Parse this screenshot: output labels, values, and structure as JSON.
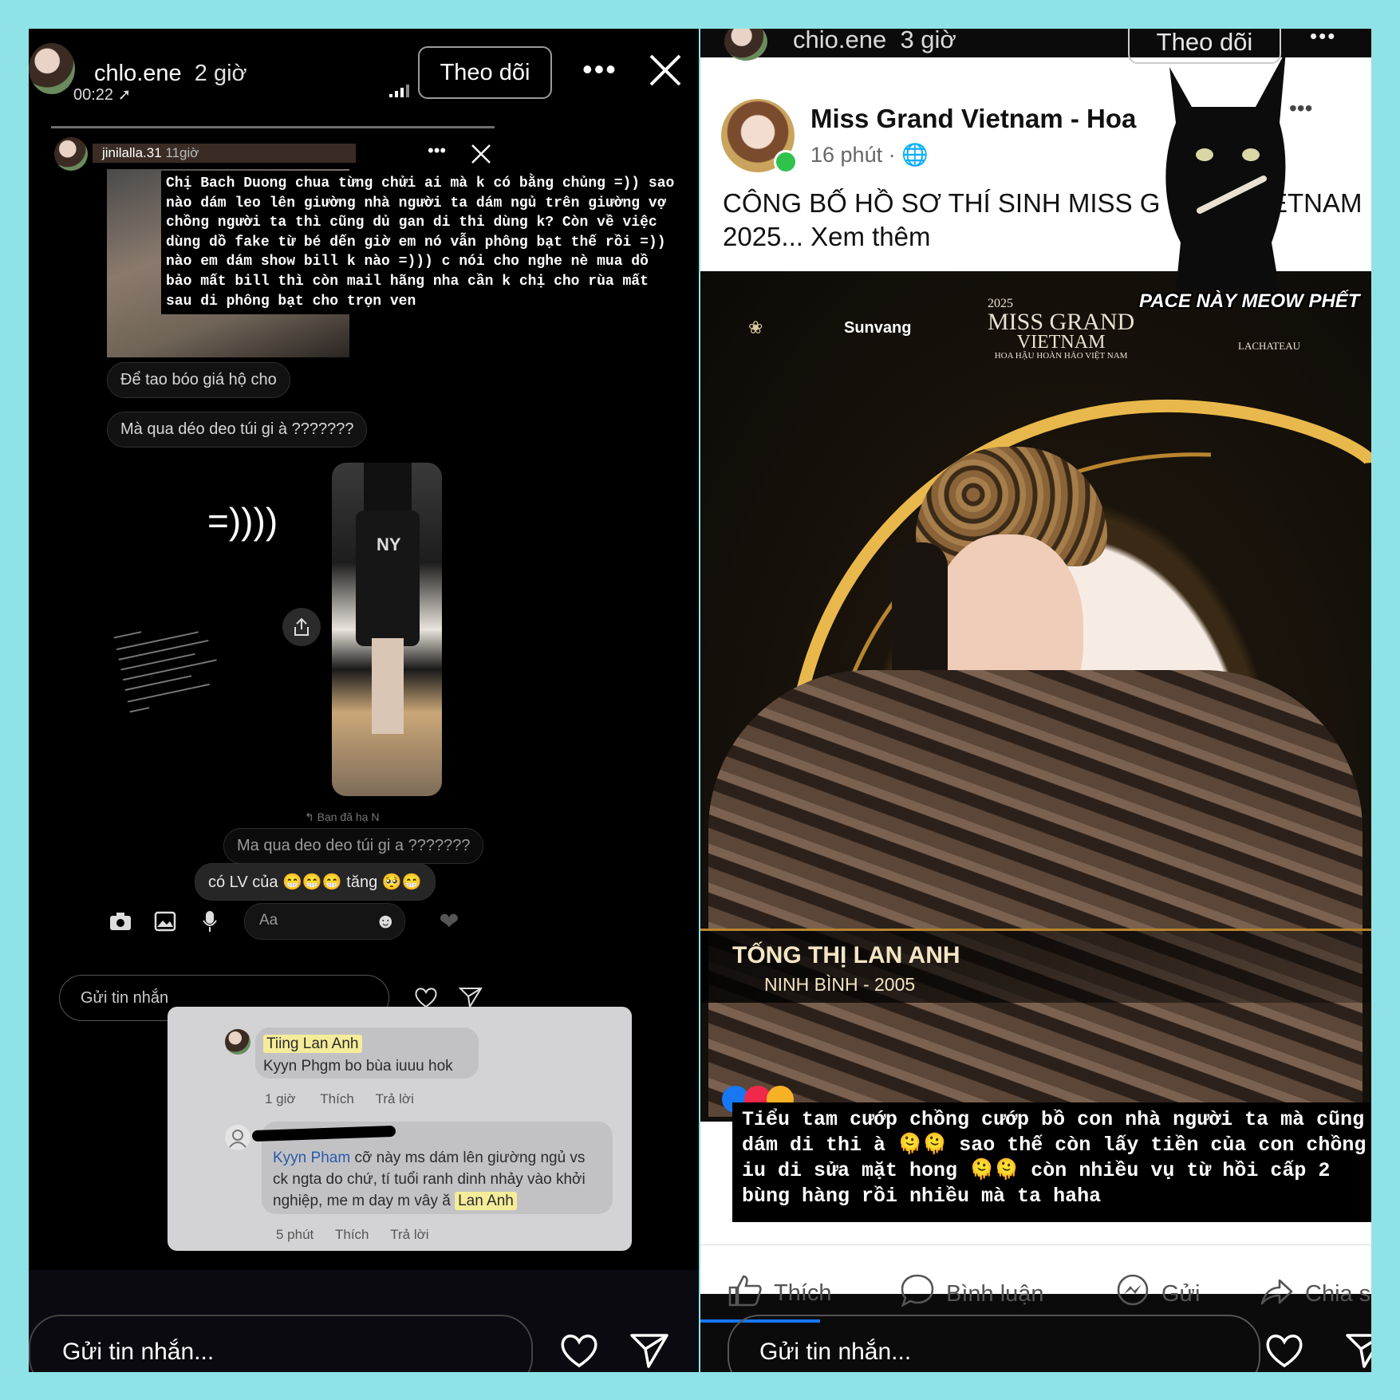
{
  "left": {
    "user": {
      "name": "chlo.ene",
      "time": "2 giờ",
      "sub_time": "00:22"
    },
    "follow_label": "Theo dõi",
    "chat": {
      "header_user": "jinilalla.31",
      "header_time": "11giờ",
      "long_message": "Chị Bach Duong chua từng chửi ai mà k có bằng chủng =)) sao nào dám leo lên giường nhà người ta dám ngủ trên giường vợ chồng người ta thì cũng dủ gan di thi dùng k? Còn về việc dùng dồ fake từ bé dến giờ em nó vẫn phông bạt thế rồi =)) nào em dám show bill k nào =))) c nói cho nghe nè mua dồ bảo mất bill thì còn mail hãng nha cần k chị cho rùa mất sau di phông bạt cho trọn ven",
      "bubble1": "Để tao bóo giá hộ cho",
      "bubble2": "Mà qua déo deo túi gi à ???????",
      "emoticon": "=))))",
      "replied_note": "Bạn đã hạ N",
      "reply_quote": "Ma qua deo deo túi gi a ???????",
      "reply_text": "có LV  của",
      "reply_tail": "tăng",
      "input_placeholder": "Aa"
    },
    "inner_send_placeholder": "Gửi tin nhắn",
    "comments": [
      {
        "tag": "Tiing Lan Anh",
        "text": "Kyyn Phgm bo bùa iuuu hok",
        "time": "1 giờ",
        "like": "Thích",
        "reply": "Trả lời"
      },
      {
        "author": "Kyyn Pham",
        "text": "cỡ này ms dám lên giường ngủ vs ck ngta do chứ, tí tuổi ranh dinh nhảy vào khởi nghiệp, me m day m vây ă",
        "tag": "Lan Anh",
        "time": "5 phút",
        "like": "Thích",
        "reply": "Trả lời"
      }
    ],
    "footer_placeholder": "Gửi tin nhắn..."
  },
  "right": {
    "user": {
      "name": "chio.ene",
      "time": "3 giờ"
    },
    "follow_label": "Theo dõi",
    "post": {
      "page_name": "Miss Grand Vietnam - Hoa",
      "time": "16 phút",
      "text_line1": "CÔNG BỐ HỒ SƠ THÍ SINH MISS G",
      "text_line1_end": "ETNAM",
      "text_line2": "2025... Xem thêm",
      "sponsor1": "Sunvang",
      "brand_year": "2025",
      "brand_line1": "MISS GRAND",
      "brand_line2": "VIETNAM",
      "brand_line3": "HOA HẬU HOÀN HẢO VIỆT NAM",
      "sponsor2": "LACHATEAU",
      "contestant_name": "TỐNG THỊ LAN ANH",
      "contestant_info": "NINH BÌNH - 2005",
      "meme_caption": "PACE NÀY MEOW PHẾT",
      "overlay_text": "Tiểu tam cướp chồng cướp bồ con nhà người ta mà cũng dám di thi à 🫠🫠 sao thế còn lấy tiền của con chồng iu di sửa mặt hong 🫠🫠 còn nhiều vụ từ hồi cấp 2 bùng hàng rồi nhiều mà ta haha"
    },
    "actions": {
      "like": "Thích",
      "comment": "Bình luận",
      "send": "Gửi",
      "share": "Chia s"
    },
    "footer_placeholder": "Gửi tin nhắn..."
  },
  "colors": {
    "background": "#8fe3e6",
    "fb_blue": "#1877f2",
    "highlight": "#f5ec9a"
  }
}
